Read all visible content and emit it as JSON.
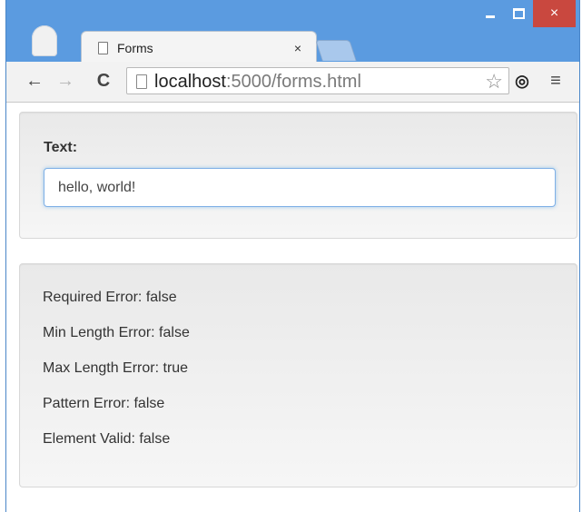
{
  "browser": {
    "tab_title": "Forms",
    "tab_close": "×",
    "url_host": "localhost",
    "url_rest": ":5000/forms.html",
    "window_buttons": {
      "close": "×"
    }
  },
  "icons": {
    "back": "back-arrow-icon",
    "forward": "forward-arrow-icon",
    "reload": "reload-icon",
    "star": "bookmark-star-icon",
    "extension": "extension-icon",
    "menu": "hamburger-menu-icon"
  },
  "form": {
    "label": "Text:",
    "value": "hello, world!"
  },
  "status": [
    "Required Error: false",
    "Min Length Error: false",
    "Max Length Error: true",
    "Pattern Error: false",
    "Element Valid: false"
  ],
  "colors": {
    "window_frame": "#5b9be0",
    "close_button": "#c9483f",
    "input_focus_border": "#7fb0e6"
  }
}
